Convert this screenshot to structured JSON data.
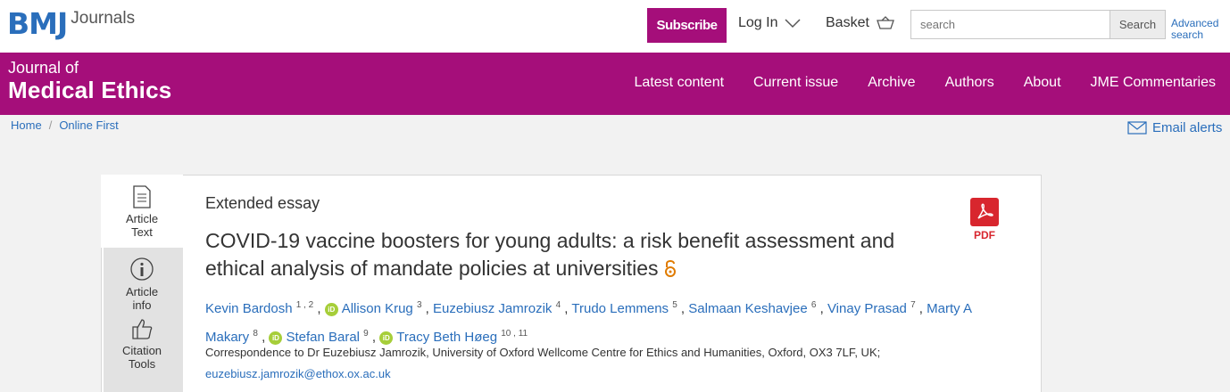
{
  "header": {
    "logo_main": "BMJ",
    "logo_sub": "Journals",
    "subscribe": "Subscribe",
    "login": "Log In",
    "basket": "Basket",
    "search_placeholder": "search",
    "search_button": "Search",
    "advanced_line1": "Advanced",
    "advanced_line2": "search"
  },
  "journal": {
    "title_small": "Journal of",
    "title_big": "Medical Ethics"
  },
  "nav": [
    "Latest content",
    "Current issue",
    "Archive",
    "Authors",
    "About",
    "JME Commentaries"
  ],
  "breadcrumb": {
    "home": "Home",
    "sep": "/",
    "current": "Online First"
  },
  "email_alerts": "Email alerts",
  "side_tabs": {
    "article_text_1": "Article",
    "article_text_2": "Text",
    "article_info_1": "Article",
    "article_info_2": "info",
    "citation_1": "Citation",
    "citation_2": "Tools"
  },
  "article": {
    "type": "Extended essay",
    "title": "COVID-19 vaccine boosters for young adults: a risk benefit assessment and ethical analysis of mandate policies at universities",
    "pdf_label": "PDF",
    "authors": [
      {
        "name": "Kevin Bardosh",
        "sup": "1 , 2",
        "orcid": false
      },
      {
        "name": "Allison Krug",
        "sup": "3",
        "orcid": true
      },
      {
        "name": "Euzebiusz Jamrozik",
        "sup": "4",
        "orcid": false
      },
      {
        "name": "Trudo Lemmens",
        "sup": "5",
        "orcid": false
      },
      {
        "name": "Salmaan Keshavjee",
        "sup": "6",
        "orcid": false
      },
      {
        "name": "Vinay Prasad",
        "sup": "7",
        "orcid": false
      },
      {
        "name": "Marty A Makary",
        "sup": "8",
        "orcid": false
      },
      {
        "name": "Stefan Baral",
        "sup": "9",
        "orcid": true
      },
      {
        "name": "Tracy Beth Høeg",
        "sup": "10 , 11",
        "orcid": true
      }
    ],
    "orcid_label": "iD",
    "correspondence": "Correspondence to Dr Euzebiusz Jamrozik, University of Oxford Wellcome Centre for Ethics and Humanities, Oxford, OX3 7LF, UK;",
    "email": "euzebiusz.jamrozik@ethox.ox.ac.uk"
  },
  "colors": {
    "brand": "#a50e7a",
    "link": "#2a6ebb",
    "open_access": "#e07b00",
    "pdf": "#d8262e",
    "orcid": "#a6ce39"
  }
}
